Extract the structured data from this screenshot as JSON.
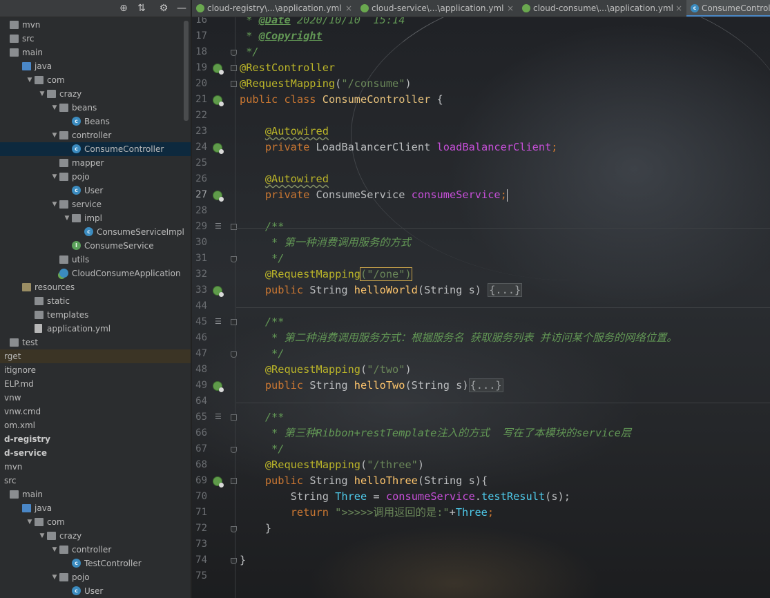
{
  "left_panel": {
    "toolbar_icons": [
      "target-icon",
      "collapse-all-icon",
      "gear-icon",
      "minimize-icon"
    ],
    "tree": [
      {
        "label": "mvn",
        "indent": 0,
        "icon": "folder",
        "arrow": "",
        "style": ""
      },
      {
        "label": "src",
        "indent": 0,
        "icon": "folder",
        "arrow": "",
        "style": ""
      },
      {
        "label": "main",
        "indent": 0,
        "icon": "folder",
        "arrow": "",
        "style": ""
      },
      {
        "label": "java",
        "indent": 1,
        "icon": "folder-src",
        "arrow": "",
        "style": ""
      },
      {
        "label": "com",
        "indent": 2,
        "icon": "folder",
        "arrow": "▼",
        "style": ""
      },
      {
        "label": "crazy",
        "indent": 3,
        "icon": "folder",
        "arrow": "▼",
        "style": ""
      },
      {
        "label": "beans",
        "indent": 4,
        "icon": "folder",
        "arrow": "▼",
        "style": ""
      },
      {
        "label": "Beans",
        "indent": 5,
        "icon": "class",
        "arrow": "",
        "style": ""
      },
      {
        "label": "controller",
        "indent": 4,
        "icon": "folder",
        "arrow": "▼",
        "style": ""
      },
      {
        "label": "ConsumeController",
        "indent": 5,
        "icon": "class",
        "arrow": "",
        "style": "selected"
      },
      {
        "label": "mapper",
        "indent": 4,
        "icon": "folder",
        "arrow": "",
        "style": ""
      },
      {
        "label": "pojo",
        "indent": 4,
        "icon": "folder",
        "arrow": "▼",
        "style": ""
      },
      {
        "label": "User",
        "indent": 5,
        "icon": "class",
        "arrow": "",
        "style": ""
      },
      {
        "label": "service",
        "indent": 4,
        "icon": "folder",
        "arrow": "▼",
        "style": ""
      },
      {
        "label": "impl",
        "indent": 5,
        "icon": "folder",
        "arrow": "▼",
        "style": ""
      },
      {
        "label": "ConsumeServiceImpl",
        "indent": 6,
        "icon": "class",
        "arrow": "",
        "style": ""
      },
      {
        "label": "ConsumeService",
        "indent": 5,
        "icon": "interface",
        "arrow": "",
        "style": ""
      },
      {
        "label": "utils",
        "indent": 4,
        "icon": "folder",
        "arrow": "",
        "style": ""
      },
      {
        "label": "CloudConsumeApplication",
        "indent": 4,
        "icon": "spring-class",
        "arrow": "",
        "style": ""
      },
      {
        "label": "resources",
        "indent": 1,
        "icon": "folder-res",
        "arrow": "",
        "style": ""
      },
      {
        "label": "static",
        "indent": 2,
        "icon": "folder",
        "arrow": "",
        "style": ""
      },
      {
        "label": "templates",
        "indent": 2,
        "icon": "folder",
        "arrow": "",
        "style": ""
      },
      {
        "label": "application.yml",
        "indent": 2,
        "icon": "yml",
        "arrow": "",
        "style": ""
      },
      {
        "label": "test",
        "indent": 0,
        "icon": "folder",
        "arrow": "",
        "style": ""
      },
      {
        "label": "rget",
        "indent": 0,
        "icon": "",
        "arrow": "",
        "style": "hilite"
      },
      {
        "label": "itignore",
        "indent": 0,
        "icon": "",
        "arrow": "",
        "style": ""
      },
      {
        "label": "ELP.md",
        "indent": 0,
        "icon": "",
        "arrow": "",
        "style": ""
      },
      {
        "label": "vnw",
        "indent": 0,
        "icon": "",
        "arrow": "",
        "style": ""
      },
      {
        "label": "vnw.cmd",
        "indent": 0,
        "icon": "",
        "arrow": "",
        "style": ""
      },
      {
        "label": "om.xml",
        "indent": 0,
        "icon": "",
        "arrow": "",
        "style": ""
      },
      {
        "label": "d-registry",
        "indent": 0,
        "icon": "",
        "arrow": "",
        "style": "bold"
      },
      {
        "label": "d-service",
        "indent": 0,
        "icon": "",
        "arrow": "",
        "style": "bold"
      },
      {
        "label": "mvn",
        "indent": 0,
        "icon": "",
        "arrow": "",
        "style": ""
      },
      {
        "label": "src",
        "indent": 0,
        "icon": "",
        "arrow": "",
        "style": ""
      },
      {
        "label": "main",
        "indent": 0,
        "icon": "folder",
        "arrow": "",
        "style": ""
      },
      {
        "label": "java",
        "indent": 1,
        "icon": "folder-src",
        "arrow": "",
        "style": ""
      },
      {
        "label": "com",
        "indent": 2,
        "icon": "folder",
        "arrow": "▼",
        "style": ""
      },
      {
        "label": "crazy",
        "indent": 3,
        "icon": "folder",
        "arrow": "▼",
        "style": ""
      },
      {
        "label": "controller",
        "indent": 4,
        "icon": "folder",
        "arrow": "▼",
        "style": ""
      },
      {
        "label": "TestController",
        "indent": 5,
        "icon": "class",
        "arrow": "",
        "style": ""
      },
      {
        "label": "pojo",
        "indent": 4,
        "icon": "folder",
        "arrow": "▼",
        "style": ""
      },
      {
        "label": "User",
        "indent": 5,
        "icon": "class",
        "arrow": "",
        "style": ""
      }
    ]
  },
  "tabs": [
    {
      "label": "cloud-registry\\...\\application.yml",
      "icon": "yml",
      "close": "×",
      "active": false
    },
    {
      "label": "cloud-service\\...\\application.yml",
      "icon": "yml",
      "close": "×",
      "active": false
    },
    {
      "label": "cloud-consume\\...\\application.yml",
      "icon": "yml",
      "close": "×",
      "active": false
    },
    {
      "label": "ConsumeController.java",
      "icon": "class",
      "close": "",
      "active": true
    }
  ],
  "editor": {
    "current_line": 27,
    "lines": [
      {
        "n": "16",
        "gutter": "",
        "tokens": [
          [
            "doc",
            " * "
          ],
          [
            "doctag",
            "@Date"
          ],
          [
            "doc",
            " 2020/10/10  15:14"
          ]
        ]
      },
      {
        "n": "17",
        "gutter": "",
        "tokens": [
          [
            "doc",
            " * "
          ],
          [
            "doctag",
            "@Copyright"
          ]
        ]
      },
      {
        "n": "18",
        "gutter": "fold-bot",
        "tokens": [
          [
            "doc",
            " */"
          ]
        ]
      },
      {
        "n": "19",
        "gutter": "bean-fold",
        "tokens": [
          [
            "ann",
            "@RestController"
          ]
        ]
      },
      {
        "n": "20",
        "gutter": "fold-top",
        "tokens": [
          [
            "ann",
            "@RequestMapping"
          ],
          [
            "plain",
            "("
          ],
          [
            "str",
            "\"/consume\""
          ],
          [
            "plain",
            ")"
          ]
        ]
      },
      {
        "n": "21",
        "gutter": "bean",
        "tokens": [
          [
            "kw",
            "public class "
          ],
          [
            "cls",
            "ConsumeController"
          ],
          [
            "plain",
            " {"
          ]
        ]
      },
      {
        "n": "22",
        "gutter": "",
        "tokens": []
      },
      {
        "n": "23",
        "gutter": "",
        "tokens": [
          [
            "plain",
            "    "
          ],
          [
            "ann-sq",
            "@Autowired"
          ]
        ]
      },
      {
        "n": "24",
        "gutter": "bean",
        "tokens": [
          [
            "plain",
            "    "
          ],
          [
            "kw",
            "private "
          ],
          [
            "plain",
            "LoadBalancerClient "
          ],
          [
            "fld",
            "loadBalancerClient"
          ],
          [
            "kw",
            ";"
          ]
        ]
      },
      {
        "n": "25",
        "gutter": "",
        "tokens": []
      },
      {
        "n": "26",
        "gutter": "",
        "tokens": [
          [
            "plain",
            "    "
          ],
          [
            "ann-sq",
            "@Autowired"
          ]
        ]
      },
      {
        "n": "27",
        "gutter": "bean",
        "tokens": [
          [
            "plain",
            "    "
          ],
          [
            "kw",
            "private "
          ],
          [
            "plain",
            "ConsumeService "
          ],
          [
            "fld",
            "consumeService"
          ],
          [
            "kw",
            ";"
          ],
          [
            "caret",
            ""
          ]
        ]
      },
      {
        "n": "28",
        "gutter": "",
        "tokens": []
      },
      {
        "n": "29",
        "gutter": "doc-fold",
        "tokens": [
          [
            "plain",
            "    "
          ],
          [
            "doc",
            "/**"
          ]
        ]
      },
      {
        "n": "30",
        "gutter": "",
        "tokens": [
          [
            "plain",
            "    "
          ],
          [
            "doc",
            " * 第一种消费调用服务的方式"
          ]
        ]
      },
      {
        "n": "31",
        "gutter": "fold-bot",
        "tokens": [
          [
            "plain",
            "    "
          ],
          [
            "doc",
            " */"
          ]
        ]
      },
      {
        "n": "32",
        "gutter": "",
        "tokens": [
          [
            "plain",
            "    "
          ],
          [
            "ann",
            "@RequestMapping"
          ],
          [
            "box",
            "(\"/one\")"
          ]
        ]
      },
      {
        "n": "33",
        "gutter": "bean",
        "tokens": [
          [
            "plain",
            "    "
          ],
          [
            "kw",
            "public "
          ],
          [
            "plain",
            "String "
          ],
          [
            "meth",
            "helloWorld"
          ],
          [
            "plain",
            "(String s) "
          ],
          [
            "fold",
            "{...}"
          ]
        ]
      },
      {
        "n": "44",
        "gutter": "",
        "tokens": []
      },
      {
        "n": "45",
        "gutter": "doc-fold",
        "tokens": [
          [
            "plain",
            "    "
          ],
          [
            "doc",
            "/**"
          ]
        ]
      },
      {
        "n": "46",
        "gutter": "",
        "tokens": [
          [
            "plain",
            "    "
          ],
          [
            "doc",
            " * 第二种消费调用服务方式：根据服务名 获取服务列表 并访问某个服务的网络位置。"
          ]
        ]
      },
      {
        "n": "47",
        "gutter": "fold-bot",
        "tokens": [
          [
            "plain",
            "    "
          ],
          [
            "doc",
            " */"
          ]
        ]
      },
      {
        "n": "48",
        "gutter": "",
        "tokens": [
          [
            "plain",
            "    "
          ],
          [
            "ann",
            "@RequestMapping"
          ],
          [
            "plain",
            "("
          ],
          [
            "str",
            "\"/two\""
          ],
          [
            "plain",
            ")"
          ]
        ]
      },
      {
        "n": "49",
        "gutter": "bean",
        "tokens": [
          [
            "plain",
            "    "
          ],
          [
            "kw",
            "public "
          ],
          [
            "plain",
            "String "
          ],
          [
            "meth",
            "helloTwo"
          ],
          [
            "plain",
            "(String s)"
          ],
          [
            "fold",
            "{...}"
          ]
        ]
      },
      {
        "n": "64",
        "gutter": "",
        "tokens": []
      },
      {
        "n": "65",
        "gutter": "doc-fold",
        "tokens": [
          [
            "plain",
            "    "
          ],
          [
            "doc",
            "/**"
          ]
        ]
      },
      {
        "n": "66",
        "gutter": "",
        "tokens": [
          [
            "plain",
            "    "
          ],
          [
            "doc",
            " * 第三种Ribbon+restTemplate注入的方式  写在了本模块的service层"
          ]
        ]
      },
      {
        "n": "67",
        "gutter": "fold-bot",
        "tokens": [
          [
            "plain",
            "    "
          ],
          [
            "doc",
            " */"
          ]
        ]
      },
      {
        "n": "68",
        "gutter": "",
        "tokens": [
          [
            "plain",
            "    "
          ],
          [
            "ann",
            "@RequestMapping"
          ],
          [
            "plain",
            "("
          ],
          [
            "str",
            "\"/three\""
          ],
          [
            "plain",
            ")"
          ]
        ]
      },
      {
        "n": "69",
        "gutter": "bean-fold",
        "tokens": [
          [
            "plain",
            "    "
          ],
          [
            "kw",
            "public "
          ],
          [
            "plain",
            "String "
          ],
          [
            "meth",
            "helloThree"
          ],
          [
            "plain",
            "(String s){"
          ]
        ]
      },
      {
        "n": "70",
        "gutter": "",
        "tokens": [
          [
            "plain",
            "        String "
          ],
          [
            "local",
            "Three"
          ],
          [
            "plain",
            " = "
          ],
          [
            "fld",
            "consumeService"
          ],
          [
            "plain",
            "."
          ],
          [
            "local",
            "testResult"
          ],
          [
            "plain",
            "(s);"
          ]
        ]
      },
      {
        "n": "71",
        "gutter": "",
        "tokens": [
          [
            "plain",
            "        "
          ],
          [
            "kw",
            "return "
          ],
          [
            "str",
            "\">>>>>调用返回的是:\""
          ],
          [
            "plain",
            "+"
          ],
          [
            "local",
            "Three"
          ],
          [
            "kw",
            ";"
          ]
        ]
      },
      {
        "n": "72",
        "gutter": "fold-bot",
        "tokens": [
          [
            "plain",
            "    }"
          ]
        ]
      },
      {
        "n": "73",
        "gutter": "",
        "tokens": []
      },
      {
        "n": "74",
        "gutter": "fold-bot",
        "tokens": [
          [
            "plain",
            "}"
          ]
        ]
      },
      {
        "n": "75",
        "gutter": "",
        "tokens": []
      }
    ]
  }
}
